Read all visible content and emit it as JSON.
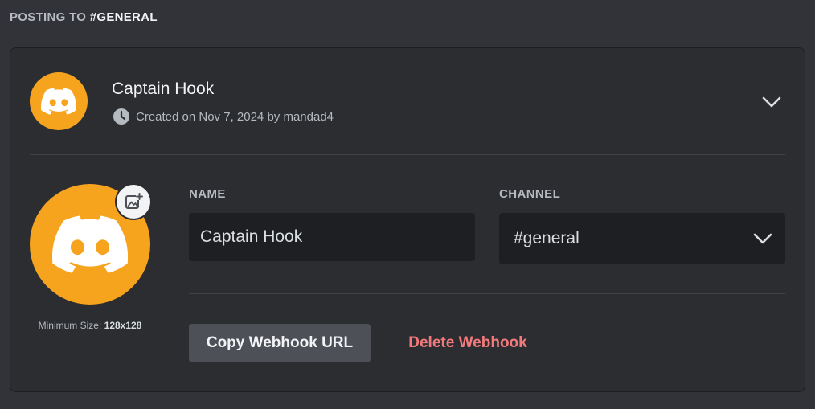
{
  "header": {
    "prefix": "POSTING TO ",
    "channel": "#GENERAL"
  },
  "webhook": {
    "name": "Captain Hook",
    "created": "Created on Nov 7, 2024 by mandad4"
  },
  "avatar": {
    "min_size_label": "Minimum Size: ",
    "min_size_value": "128x128",
    "color": "#f6a31e"
  },
  "fields": {
    "name_label": "NAME",
    "name_value": "Captain Hook",
    "channel_label": "CHANNEL",
    "channel_value": "#general"
  },
  "actions": {
    "copy_label": "Copy Webhook URL",
    "delete_label": "Delete Webhook"
  },
  "icons": [
    "discord-logo-icon",
    "clock-icon",
    "chevron-down-icon",
    "image-add-icon"
  ]
}
